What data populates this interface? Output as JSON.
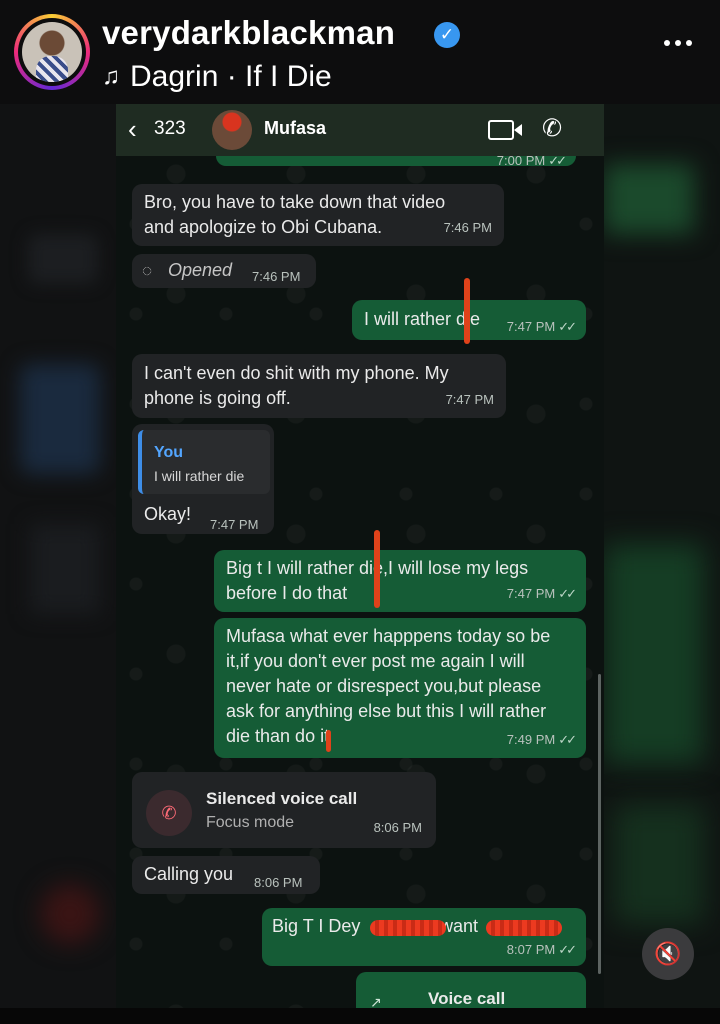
{
  "story": {
    "username": "verydarkblackman",
    "verified_glyph": "✓",
    "music_icon": "music-note-icon",
    "music": "Dagrin · If I Die"
  },
  "chat": {
    "back_count": "323",
    "contact_name": "Mufasa",
    "prev_time": "7:00 PM",
    "messages": [
      {
        "text": "Bro, you have to take down that video and apologize to Obi Cubana.",
        "time": "7:46 PM"
      },
      {
        "text": "Opened",
        "time": "7:46 PM"
      },
      {
        "text": "I will rather die",
        "time": "7:47 PM"
      },
      {
        "text": "I can't even do shit with my phone. My phone is going off.",
        "time": "7:47 PM"
      },
      {
        "quote_author": "You",
        "quote_text": "I will rather die",
        "text": "Okay!",
        "time": "7:47 PM"
      },
      {
        "text": "Big t I will rather die,I will lose my legs before I do that",
        "time": "7:47 PM"
      },
      {
        "text": "Mufasa what ever happpens today so be it,if you don't ever post me again I will never hate or disrespect you,but please ask for anything else but this I will rather die than do it",
        "time": "7:49 PM"
      },
      {
        "title": "Silenced voice call",
        "subtitle": "Focus mode",
        "time": "8:06 PM"
      },
      {
        "text": "Calling you",
        "time": "8:06 PM"
      },
      {
        "text_a": "Big T I Dey",
        "text_b": "want",
        "time": "8:07 PM"
      },
      {
        "title": "Voice call"
      }
    ]
  },
  "colors": {
    "incoming_bubble": "#212325",
    "outgoing_bubble": "#155c36",
    "redaction": "#e0421a",
    "quote_author": "#53a6ff"
  }
}
